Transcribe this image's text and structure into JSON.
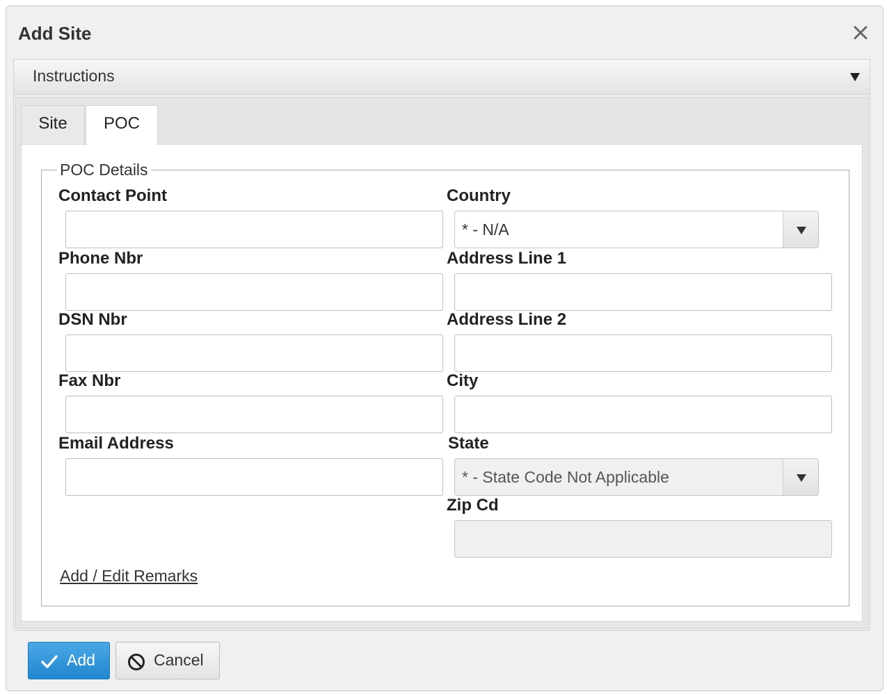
{
  "dialog": {
    "title": "Add Site",
    "close_icon": "close-icon"
  },
  "instructions": {
    "label": "Instructions",
    "icon": "caret-down-icon"
  },
  "tabs": [
    {
      "label": "Site",
      "active": false
    },
    {
      "label": "POC",
      "active": true
    }
  ],
  "poc": {
    "legend": "POC Details",
    "contact_point": {
      "label": "Contact Point",
      "value": ""
    },
    "phone_nbr": {
      "label": "Phone Nbr",
      "value": ""
    },
    "dsn_nbr": {
      "label": "DSN Nbr",
      "value": ""
    },
    "fax_nbr": {
      "label": "Fax Nbr",
      "value": ""
    },
    "email": {
      "label": "Email Address",
      "value": ""
    },
    "country": {
      "label": "Country",
      "value": "* - N/A"
    },
    "address1": {
      "label": "Address Line 1",
      "value": ""
    },
    "address2": {
      "label": "Address Line 2",
      "value": ""
    },
    "city": {
      "label": "City",
      "value": ""
    },
    "state": {
      "label": "State",
      "value": "* - State Code Not Applicable",
      "disabled": true
    },
    "zip": {
      "label": "Zip Cd",
      "value": "",
      "disabled": true
    },
    "remarks_link": "Add / Edit Remarks"
  },
  "footer": {
    "add_label": "Add",
    "cancel_label": "Cancel",
    "add_color": "#2a8fd8"
  }
}
